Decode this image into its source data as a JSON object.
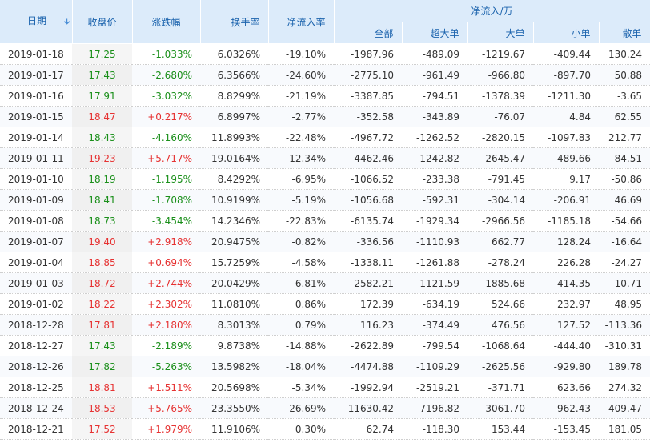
{
  "header": {
    "date": "日期",
    "close": "收盘价",
    "change_pct": "涨跌幅",
    "turnover": "换手率",
    "net_inflow_rate": "净流入率",
    "net_inflow_group": "净流入/万",
    "all": "全部",
    "super_large": "超大单",
    "large": "大单",
    "small": "小单",
    "retail": "散单"
  },
  "colors": {
    "up": "#e63232",
    "down": "#1a8f1a",
    "header_bg": "#dcebfa",
    "header_text": "#1b63ad"
  },
  "rows": [
    {
      "date": "2019-01-18",
      "close": "17.25",
      "change": "-1.033%",
      "turnover": "6.0326%",
      "rate": "-19.10%",
      "all": "-1987.96",
      "super": "-489.09",
      "large": "-1219.67",
      "small": "-409.44",
      "retail": "130.24",
      "dir": "down"
    },
    {
      "date": "2019-01-17",
      "close": "17.43",
      "change": "-2.680%",
      "turnover": "6.3566%",
      "rate": "-24.60%",
      "all": "-2775.10",
      "super": "-961.49",
      "large": "-966.80",
      "small": "-897.70",
      "retail": "50.88",
      "dir": "down"
    },
    {
      "date": "2019-01-16",
      "close": "17.91",
      "change": "-3.032%",
      "turnover": "8.8299%",
      "rate": "-21.19%",
      "all": "-3387.85",
      "super": "-794.51",
      "large": "-1378.39",
      "small": "-1211.30",
      "retail": "-3.65",
      "dir": "down"
    },
    {
      "date": "2019-01-15",
      "close": "18.47",
      "change": "+0.217%",
      "turnover": "6.8997%",
      "rate": "-2.77%",
      "all": "-352.58",
      "super": "-343.89",
      "large": "-76.07",
      "small": "4.84",
      "retail": "62.55",
      "dir": "up"
    },
    {
      "date": "2019-01-14",
      "close": "18.43",
      "change": "-4.160%",
      "turnover": "11.8993%",
      "rate": "-22.48%",
      "all": "-4967.72",
      "super": "-1262.52",
      "large": "-2820.15",
      "small": "-1097.83",
      "retail": "212.77",
      "dir": "down"
    },
    {
      "date": "2019-01-11",
      "close": "19.23",
      "change": "+5.717%",
      "turnover": "19.0164%",
      "rate": "12.34%",
      "all": "4462.46",
      "super": "1242.82",
      "large": "2645.47",
      "small": "489.66",
      "retail": "84.51",
      "dir": "up"
    },
    {
      "date": "2019-01-10",
      "close": "18.19",
      "change": "-1.195%",
      "turnover": "8.4292%",
      "rate": "-6.95%",
      "all": "-1066.52",
      "super": "-233.38",
      "large": "-791.45",
      "small": "9.17",
      "retail": "-50.86",
      "dir": "down"
    },
    {
      "date": "2019-01-09",
      "close": "18.41",
      "change": "-1.708%",
      "turnover": "10.9199%",
      "rate": "-5.19%",
      "all": "-1056.68",
      "super": "-592.31",
      "large": "-304.14",
      "small": "-206.91",
      "retail": "46.69",
      "dir": "down"
    },
    {
      "date": "2019-01-08",
      "close": "18.73",
      "change": "-3.454%",
      "turnover": "14.2346%",
      "rate": "-22.83%",
      "all": "-6135.74",
      "super": "-1929.34",
      "large": "-2966.56",
      "small": "-1185.18",
      "retail": "-54.66",
      "dir": "down"
    },
    {
      "date": "2019-01-07",
      "close": "19.40",
      "change": "+2.918%",
      "turnover": "20.9475%",
      "rate": "-0.82%",
      "all": "-336.56",
      "super": "-1110.93",
      "large": "662.77",
      "small": "128.24",
      "retail": "-16.64",
      "dir": "up"
    },
    {
      "date": "2019-01-04",
      "close": "18.85",
      "change": "+0.694%",
      "turnover": "15.7259%",
      "rate": "-4.58%",
      "all": "-1338.11",
      "super": "-1261.88",
      "large": "-278.24",
      "small": "226.28",
      "retail": "-24.27",
      "dir": "up"
    },
    {
      "date": "2019-01-03",
      "close": "18.72",
      "change": "+2.744%",
      "turnover": "20.0429%",
      "rate": "6.81%",
      "all": "2582.21",
      "super": "1121.59",
      "large": "1885.68",
      "small": "-414.35",
      "retail": "-10.71",
      "dir": "up"
    },
    {
      "date": "2019-01-02",
      "close": "18.22",
      "change": "+2.302%",
      "turnover": "11.0810%",
      "rate": "0.86%",
      "all": "172.39",
      "super": "-634.19",
      "large": "524.66",
      "small": "232.97",
      "retail": "48.95",
      "dir": "up"
    },
    {
      "date": "2018-12-28",
      "close": "17.81",
      "change": "+2.180%",
      "turnover": "8.3013%",
      "rate": "0.79%",
      "all": "116.23",
      "super": "-374.49",
      "large": "476.56",
      "small": "127.52",
      "retail": "-113.36",
      "dir": "up"
    },
    {
      "date": "2018-12-27",
      "close": "17.43",
      "change": "-2.189%",
      "turnover": "9.8738%",
      "rate": "-14.88%",
      "all": "-2622.89",
      "super": "-799.54",
      "large": "-1068.64",
      "small": "-444.40",
      "retail": "-310.31",
      "dir": "down"
    },
    {
      "date": "2018-12-26",
      "close": "17.82",
      "change": "-5.263%",
      "turnover": "13.5982%",
      "rate": "-18.04%",
      "all": "-4474.88",
      "super": "-1109.29",
      "large": "-2625.56",
      "small": "-929.80",
      "retail": "189.78",
      "dir": "down"
    },
    {
      "date": "2018-12-25",
      "close": "18.81",
      "change": "+1.511%",
      "turnover": "20.5698%",
      "rate": "-5.34%",
      "all": "-1992.94",
      "super": "-2519.21",
      "large": "-371.71",
      "small": "623.66",
      "retail": "274.32",
      "dir": "up"
    },
    {
      "date": "2018-12-24",
      "close": "18.53",
      "change": "+5.765%",
      "turnover": "23.3550%",
      "rate": "26.69%",
      "all": "11630.42",
      "super": "7196.82",
      "large": "3061.70",
      "small": "962.43",
      "retail": "409.47",
      "dir": "up"
    },
    {
      "date": "2018-12-21",
      "close": "17.52",
      "change": "+1.979%",
      "turnover": "11.9106%",
      "rate": "0.30%",
      "all": "62.74",
      "super": "-118.30",
      "large": "153.44",
      "small": "-153.45",
      "retail": "181.05",
      "dir": "up"
    }
  ]
}
